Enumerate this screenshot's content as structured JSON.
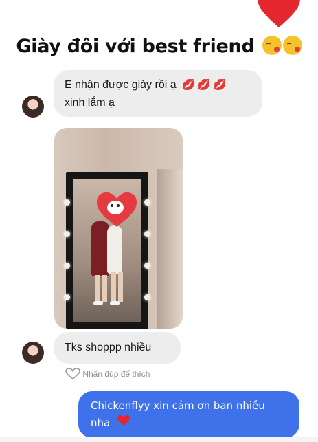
{
  "story": {
    "title": "Giày đôi với best friend"
  },
  "chat": {
    "message_1_line1": "E nhận được giày rồi ạ",
    "message_1_emojis": "💋 💋 💋",
    "message_1_line2": "xinh lắm ạ",
    "message_2": "Tks shoppp nhiều",
    "like_hint": "Nhấn đúp để thích",
    "reply": "Chickenflyy xin cảm ơn bạn nhiều nha"
  },
  "colors": {
    "accent": "#3f71ea",
    "heart": "#e4262f",
    "bubble": "#ededed"
  }
}
